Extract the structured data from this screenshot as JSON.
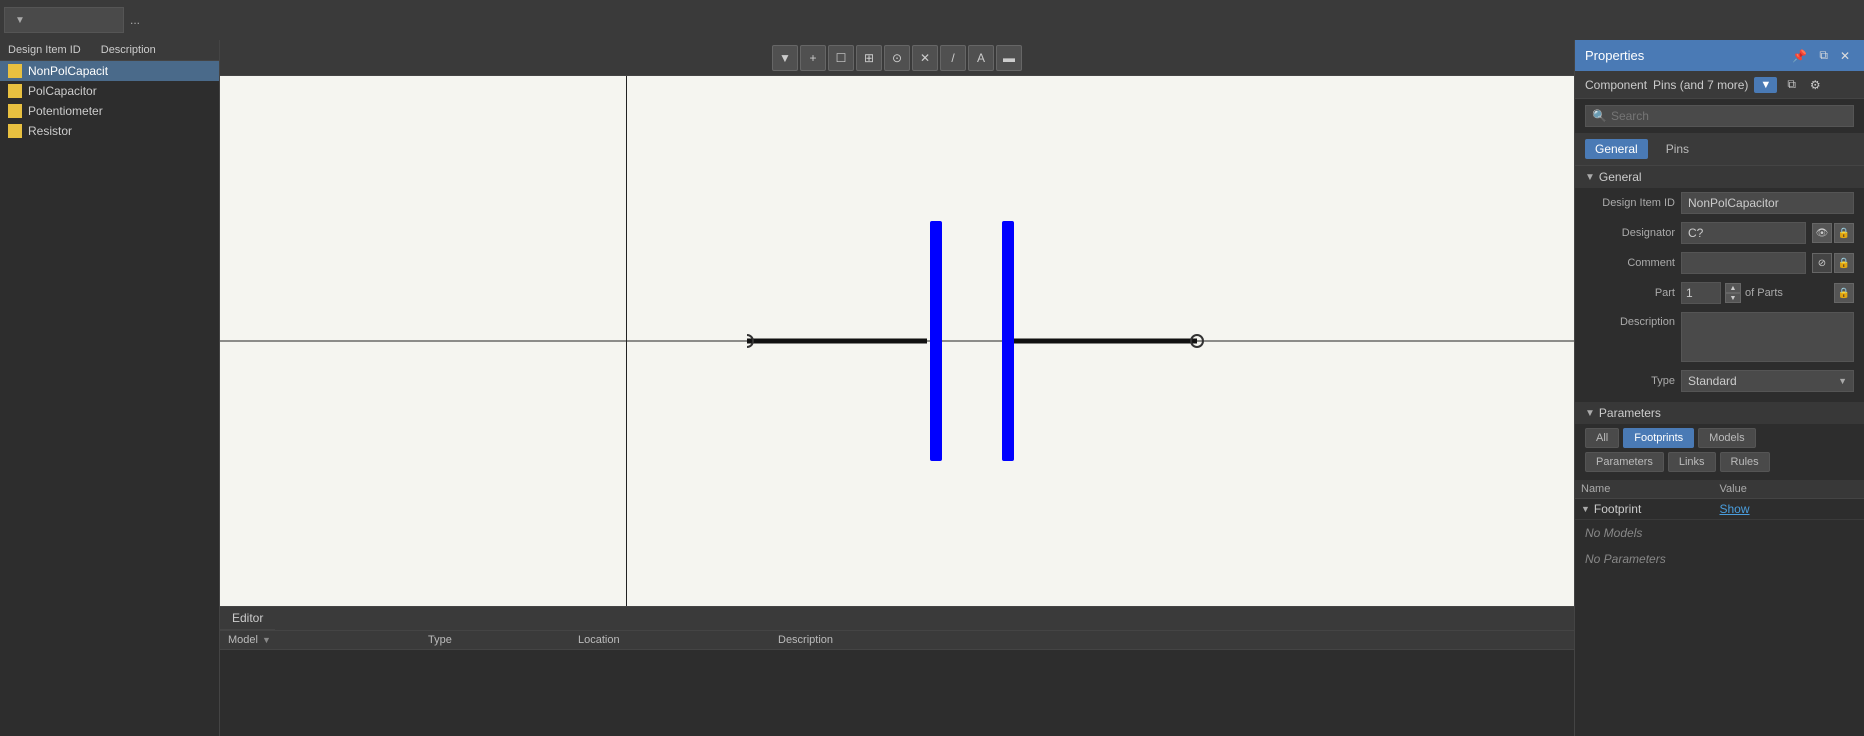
{
  "topbar": {
    "dropdown_label": "",
    "dots_label": "..."
  },
  "leftpanel": {
    "col1": "Design Item ID",
    "col2": "Description",
    "items": [
      {
        "id": "NonPolCapacit",
        "description": "",
        "selected": true
      },
      {
        "id": "PolCapacitor",
        "description": "",
        "selected": false
      },
      {
        "id": "Potentiometer",
        "description": "",
        "selected": false
      },
      {
        "id": "Resistor",
        "description": "",
        "selected": false
      }
    ]
  },
  "canvas_toolbar": {
    "buttons": [
      "▼",
      "+",
      "☐",
      "⊞",
      "⊙",
      "✕",
      "/",
      "A",
      "▬"
    ]
  },
  "bottom_panel": {
    "tab_label": "Editor",
    "columns": [
      "Model",
      "Type",
      "Location",
      "Description"
    ]
  },
  "properties": {
    "title": "Properties",
    "pin_label": "Pins (and 7 more)",
    "search_placeholder": "Search",
    "tab_general": "General",
    "tab_pins": "Pins",
    "section_general": "General",
    "section_parameters": "Parameters",
    "fields": {
      "design_item_id_label": "Design Item ID",
      "design_item_id_value": "NonPolCapacitor",
      "designator_label": "Designator",
      "designator_value": "C?",
      "comment_label": "Comment",
      "comment_value": "",
      "part_label": "Part",
      "part_value": "1",
      "of_parts": "of Parts",
      "description_label": "Description",
      "description_value": "",
      "type_label": "Type",
      "type_value": "Standard"
    },
    "param_buttons": {
      "all": "All",
      "footprints": "Footprints",
      "models": "Models",
      "parameters": "Parameters",
      "links": "Links",
      "rules": "Rules"
    },
    "param_table": {
      "col_name": "Name",
      "col_value": "Value",
      "rows": [
        {
          "name": "Footprint",
          "value": "Show"
        }
      ]
    },
    "no_models": "No Models",
    "no_parameters": "No Parameters"
  }
}
